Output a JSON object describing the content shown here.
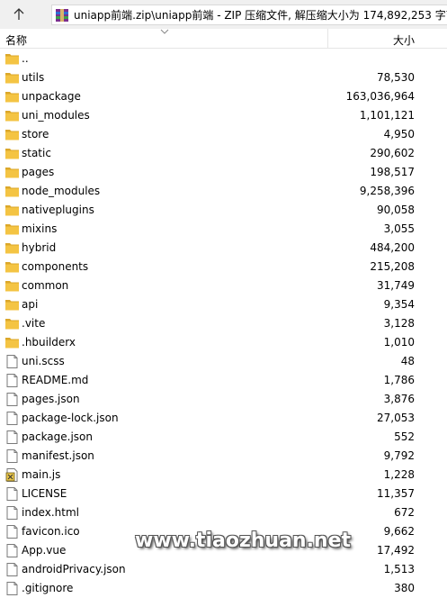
{
  "toolbar": {
    "up_icon": "up-arrow-icon",
    "archive_icon": "winrar-archive-icon",
    "path": "uniapp前端.zip\\uniapp前端 - ZIP 压缩文件, 解压缩大小为 174,892,253 字节"
  },
  "header": {
    "name_label": "名称",
    "size_label": "大小"
  },
  "files": [
    {
      "name": "..",
      "size": "",
      "type": "folder"
    },
    {
      "name": "utils",
      "size": "78,530",
      "type": "folder"
    },
    {
      "name": "unpackage",
      "size": "163,036,964",
      "type": "folder"
    },
    {
      "name": "uni_modules",
      "size": "1,101,121",
      "type": "folder"
    },
    {
      "name": "store",
      "size": "4,950",
      "type": "folder"
    },
    {
      "name": "static",
      "size": "290,602",
      "type": "folder"
    },
    {
      "name": "pages",
      "size": "198,517",
      "type": "folder"
    },
    {
      "name": "node_modules",
      "size": "9,258,396",
      "type": "folder"
    },
    {
      "name": "nativeplugins",
      "size": "90,058",
      "type": "folder"
    },
    {
      "name": "mixins",
      "size": "3,055",
      "type": "folder"
    },
    {
      "name": "hybrid",
      "size": "484,200",
      "type": "folder"
    },
    {
      "name": "components",
      "size": "215,208",
      "type": "folder"
    },
    {
      "name": "common",
      "size": "31,749",
      "type": "folder"
    },
    {
      "name": "api",
      "size": "9,354",
      "type": "folder"
    },
    {
      "name": ".vite",
      "size": "3,128",
      "type": "folder"
    },
    {
      "name": ".hbuilderx",
      "size": "1,010",
      "type": "folder"
    },
    {
      "name": "uni.scss",
      "size": "48",
      "type": "file"
    },
    {
      "name": "README.md",
      "size": "1,786",
      "type": "file"
    },
    {
      "name": "pages.json",
      "size": "3,876",
      "type": "file"
    },
    {
      "name": "package-lock.json",
      "size": "27,053",
      "type": "file"
    },
    {
      "name": "package.json",
      "size": "552",
      "type": "file"
    },
    {
      "name": "manifest.json",
      "size": "9,792",
      "type": "file"
    },
    {
      "name": "main.js",
      "size": "1,228",
      "type": "script"
    },
    {
      "name": "LICENSE",
      "size": "11,357",
      "type": "file"
    },
    {
      "name": "index.html",
      "size": "672",
      "type": "file"
    },
    {
      "name": "favicon.ico",
      "size": "9,662",
      "type": "file"
    },
    {
      "name": "App.vue",
      "size": "17,492",
      "type": "file"
    },
    {
      "name": "androidPrivacy.json",
      "size": "1,513",
      "type": "file"
    },
    {
      "name": ".gitignore",
      "size": "380",
      "type": "file"
    }
  ],
  "watermark": "www.tiaozhuan.net",
  "colors": {
    "folder": "#f4c443",
    "folder_dark": "#dba72a",
    "toolbar_bg": "#f0f0f0"
  }
}
